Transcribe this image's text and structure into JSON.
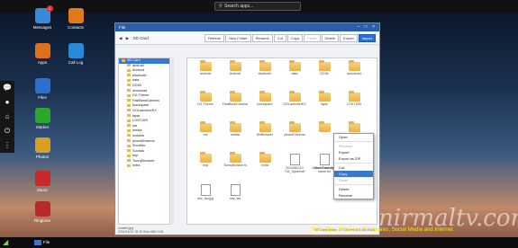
{
  "search": {
    "label": "Search apps..."
  },
  "desktop_icons": [
    {
      "name": "Messages",
      "badge": "1"
    },
    {
      "name": "Contacts"
    },
    {
      "name": "Apps"
    },
    {
      "name": "Call Log"
    },
    {
      "name": "Files"
    },
    {
      "name": "Market"
    },
    {
      "name": "Photos"
    },
    {
      "name": "Music"
    },
    {
      "name": "Ringtone"
    }
  ],
  "window": {
    "title": "File",
    "breadcrumb": [
      "SD Card"
    ],
    "toolbar": [
      "Refresh",
      "New Folder",
      "Rename",
      "Cut",
      "Copy",
      "Paste",
      "Delete",
      "Export"
    ],
    "import_label": "Import"
  },
  "tree": [
    "SD Card",
    "android",
    "Android",
    "bluetooth",
    "data",
    "DCIM",
    "download",
    "DX-Theme",
    "FastBurstCamera",
    "foursquare",
    "GOLauncherEX",
    "layar",
    "LOST.DIR",
    "me",
    "media",
    "mobiles",
    "phoneDriveme",
    "ShortMo",
    "Sounds",
    "tmp",
    "TunnyBrowser",
    "extra"
  ],
  "grid_items": [
    "android",
    "Android",
    "bluetooth",
    "data",
    "DCIM",
    "download",
    "DX-Theme",
    "FastBurstCamera",
    "foursquare",
    "GOLauncherEX",
    "layar",
    "LOST.DIR",
    "me",
    "media",
    "MxBrowser",
    "phoneDriveme",
    "",
    "Sounds",
    "tmp",
    "TunnyBrowse rs",
    "extra",
    "2011082110 734_SpeechH",
    "deviceIdentify name.txt",
    "DeleCacheHol ext09476.tmp",
    "mtv_fav.jpg",
    "mtv_fav"
  ],
  "grid_tail_item": "Airfoto Tune.mp3",
  "status": {
    "left": "content.jpg",
    "left2": "2011/01/12 16:15    Size:465.2 KB",
    "right": "SD Card Status: 1.9 GB free (4.3 GB Total)"
  },
  "context_menu": [
    "Open",
    "Rename",
    "Export",
    "Export as ZIP",
    "Cut",
    "Copy",
    "Paste",
    "Delete",
    "Rename"
  ],
  "context_menu_disabled": [
    1,
    6
  ],
  "context_menu_selected": 5,
  "taskbar": {
    "file_label": "File"
  },
  "watermark": "nirmaltv.com",
  "watermark_tagline": "Tech, Tips, Windows, Freewares, Social Media and Internet"
}
